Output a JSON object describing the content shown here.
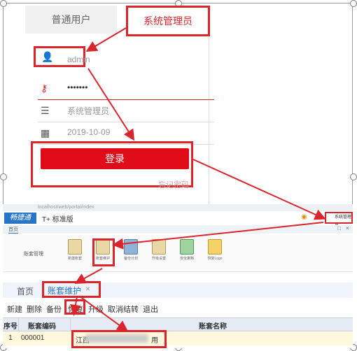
{
  "login": {
    "tab_normal": "普通用户",
    "tab_admin": "系统管理员",
    "username": "admin",
    "password_mask": "•••••••",
    "role": "系统管理员",
    "date": "2019-10-09",
    "login_button": "登录",
    "forgot": "忘记密码"
  },
  "app": {
    "url": "localhost/web/portal/index",
    "logo": "畅捷通",
    "edition": "T+ 标准版",
    "user": "系统管理员",
    "menu_home": "首页",
    "ribbon_group": "账套管理",
    "ribbon_items": [
      "新建账套",
      "账套维护",
      "备份计划",
      "升级设置",
      "安全策略",
      "恢复Logo"
    ],
    "tabs": {
      "home": "首页",
      "active": "账套维护",
      "close": "×"
    },
    "toolbar": [
      "新建",
      "删除",
      "备份",
      "恢复",
      "升级",
      "取消结转",
      "退出"
    ],
    "table": {
      "headers": [
        "序号",
        "账套编码",
        "账套名称"
      ],
      "rows": [
        {
          "num": "1",
          "code": "000001",
          "name_start": "江西",
          "name_end": "用"
        }
      ]
    }
  },
  "colors": {
    "accent_red": "#d9252b",
    "brand_blue": "#2775c4",
    "login_red": "#e00d19"
  }
}
